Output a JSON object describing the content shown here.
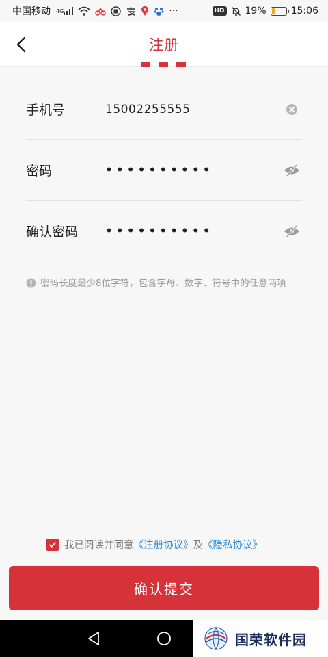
{
  "status_bar": {
    "carrier": "中国移动",
    "network": "4G",
    "battery_percent": "19%",
    "battery_level": 0.19,
    "time": "15:06",
    "hd": "HD",
    "more": "···"
  },
  "header": {
    "title": "注册"
  },
  "form": {
    "phone": {
      "label": "手机号",
      "value": "15002255555"
    },
    "password": {
      "label": "密码",
      "value": "••••••••••"
    },
    "confirm": {
      "label": "确认密码",
      "value": "••••••••••"
    }
  },
  "hint": "密码长度最少8位字符，包含字母、数字、符号中的任意两项",
  "agreement": {
    "prefix": "我已阅读并同意",
    "register_link": "《注册协议》",
    "conjunction": "及",
    "privacy_link": "《隐私协议》",
    "checked": true
  },
  "submit_label": "确认提交",
  "watermark": "国荣软件园",
  "colors": {
    "accent": "#d6323a",
    "link": "#2a8bd6"
  }
}
